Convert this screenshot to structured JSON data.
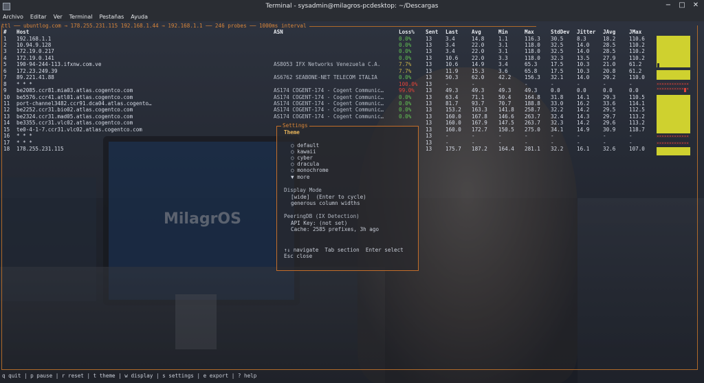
{
  "window": {
    "title": "Terminal - sysadmin@milagros-pcdesktop: ~/Descargas",
    "controls": [
      "−",
      "□",
      "✕"
    ]
  },
  "menu": [
    "Archivo",
    "Editar",
    "Ver",
    "Terminal",
    "Pestañas",
    "Ayuda"
  ],
  "header": {
    "prefix": "ttl",
    "route": "ubuntlog.com → 178.255.231.115 192.168.1.44 → 192.168.1.1",
    "probes": "246 probes",
    "interval": "1000ms interval"
  },
  "columns": [
    "#",
    "Host",
    "ASN",
    "Loss%",
    "Sent",
    "Last",
    "Avg",
    "Min",
    "Max",
    "StdDev",
    "Jitter",
    "JAvg",
    "JMax"
  ],
  "hops": [
    {
      "n": "1",
      "host": "192.168.1.1",
      "asn": "",
      "loss": "0.0%",
      "sent": "13",
      "last": "3.4",
      "avg": "14.8",
      "min": "1.1",
      "max": "116.3",
      "sd": "30.5",
      "jit": "8.3",
      "javg": "18.2",
      "jmax": "110.6",
      "lossLevel": "ok"
    },
    {
      "n": "2",
      "host": "10.94.9.128",
      "asn": "",
      "loss": "0.0%",
      "sent": "13",
      "last": "3.4",
      "avg": "22.0",
      "min": "3.1",
      "max": "118.0",
      "sd": "32.5",
      "jit": "14.0",
      "javg": "28.5",
      "jmax": "110.2",
      "lossLevel": "ok"
    },
    {
      "n": "3",
      "host": "172.19.0.217",
      "asn": "",
      "loss": "0.0%",
      "sent": "13",
      "last": "3.4",
      "avg": "22.0",
      "min": "3.1",
      "max": "118.0",
      "sd": "32.5",
      "jit": "14.0",
      "javg": "28.5",
      "jmax": "110.2",
      "lossLevel": "ok"
    },
    {
      "n": "4",
      "host": "172.19.0.141",
      "asn": "",
      "loss": "0.0%",
      "sent": "13",
      "last": "10.6",
      "avg": "22.0",
      "min": "3.3",
      "max": "118.0",
      "sd": "32.3",
      "jit": "13.5",
      "javg": "27.9",
      "jmax": "110.2",
      "lossLevel": "ok"
    },
    {
      "n": "5",
      "host": "190-94-244-113.ifxnw.com.ve",
      "asn": "AS8053 IFX Networks Venezuela C.A.",
      "loss": "7.7%",
      "sent": "13",
      "last": "10.6",
      "avg": "14.9",
      "min": "3.4",
      "max": "65.3",
      "sd": "17.5",
      "jit": "10.3",
      "javg": "21.0",
      "jmax": "61.2",
      "lossLevel": "mid"
    },
    {
      "n": "6",
      "host": "172.23.249.39",
      "asn": "",
      "loss": "7.7%",
      "sent": "13",
      "last": "11.9",
      "avg": "15.3",
      "min": "3.6",
      "max": "65.8",
      "sd": "17.5",
      "jit": "10.3",
      "javg": "20.8",
      "jmax": "61.2",
      "lossLevel": "mid"
    },
    {
      "n": "7",
      "host": "89.221.41.88",
      "asn": "AS6762 SEABONE-NET TELECOM ITALIA",
      "loss": "0.0%",
      "sent": "13",
      "last": "50.3",
      "avg": "62.0",
      "min": "42.2",
      "max": "156.3",
      "sd": "32.1",
      "jit": "14.0",
      "javg": "29.2",
      "jmax": "110.0",
      "lossLevel": "ok"
    },
    {
      "n": "8",
      "host": "* * *",
      "asn": "",
      "loss": "100.0%",
      "sent": "13",
      "last": "-",
      "avg": "-",
      "min": "-",
      "max": "-",
      "sd": "-",
      "jit": "-",
      "javg": "-",
      "jmax": "-",
      "lossLevel": "bad"
    },
    {
      "n": "9",
      "host": "be2085.ccr81.mia03.atlas.cogentco.com",
      "asn": "AS174 COGENT-174 - Cogent Communic…",
      "loss": "99.0%",
      "sent": "13",
      "last": "49.3",
      "avg": "49.3",
      "min": "49.3",
      "max": "49.3",
      "sd": "0.0",
      "jit": "0.0",
      "javg": "0.0",
      "jmax": "0.0",
      "lossLevel": "bad"
    },
    {
      "n": "10",
      "host": "be5576.ccr41.atl01.atlas.cogentco.com",
      "asn": "AS174 COGENT-174 - Cogent Communic…",
      "loss": "0.0%",
      "sent": "13",
      "last": "63.4",
      "avg": "71.1",
      "min": "50.4",
      "max": "164.8",
      "sd": "31.8",
      "jit": "14.1",
      "javg": "29.3",
      "jmax": "110.5",
      "lossLevel": "ok"
    },
    {
      "n": "11",
      "host": "port-channel3482.ccr91.dca04.atlas.cogento…",
      "asn": "AS174 COGENT-174 - Cogent Communic…",
      "loss": "0.0%",
      "sent": "13",
      "last": "81.7",
      "avg": "93.7",
      "min": "70.7",
      "max": "188.8",
      "sd": "33.0",
      "jit": "16.2",
      "javg": "33.6",
      "jmax": "114.1",
      "lossLevel": "ok"
    },
    {
      "n": "12",
      "host": "be2252.ccr31.bio02.atlas.cogentco.com",
      "asn": "AS174 COGENT-174 - Cogent Communic…",
      "loss": "0.0%",
      "sent": "13",
      "last": "153.2",
      "avg": "163.3",
      "min": "141.8",
      "max": "258.7",
      "sd": "32.2",
      "jit": "14.2",
      "javg": "29.5",
      "jmax": "112.5",
      "lossLevel": "ok"
    },
    {
      "n": "13",
      "host": "be2324.ccr31.mad05.atlas.cogentco.com",
      "asn": "AS174 COGENT-174 - Cogent Communic…",
      "loss": "0.0%",
      "sent": "13",
      "last": "160.0",
      "avg": "167.8",
      "min": "146.6",
      "max": "263.7",
      "sd": "32.4",
      "jit": "14.3",
      "javg": "29.7",
      "jmax": "113.2",
      "lossLevel": "ok"
    },
    {
      "n": "14",
      "host": "be3355.ccr31.vlc02.atlas.cogentco.com",
      "asn": "",
      "loss": "",
      "sent": "13",
      "last": "160.0",
      "avg": "167.9",
      "min": "147.5",
      "max": "263.7",
      "sd": "32.3",
      "jit": "14.2",
      "javg": "29.6",
      "jmax": "113.2",
      "lossLevel": "ok"
    },
    {
      "n": "15",
      "host": "te0-4-1-7.ccr31.vlc02.atlas.cogentco.com",
      "asn": "",
      "loss": "",
      "sent": "13",
      "last": "160.0",
      "avg": "172.7",
      "min": "150.5",
      "max": "275.0",
      "sd": "34.1",
      "jit": "14.9",
      "javg": "30.9",
      "jmax": "118.7",
      "lossLevel": "ok"
    },
    {
      "n": "16",
      "host": "* * *",
      "asn": "",
      "loss": "",
      "sent": "13",
      "last": "-",
      "avg": "-",
      "min": "-",
      "max": "-",
      "sd": "-",
      "jit": "-",
      "javg": "-",
      "jmax": "-",
      "lossLevel": "bad"
    },
    {
      "n": "17",
      "host": "* * *",
      "asn": "",
      "loss": "",
      "sent": "13",
      "last": "-",
      "avg": "-",
      "min": "-",
      "max": "-",
      "sd": "-",
      "jit": "-",
      "javg": "-",
      "jmax": "-",
      "lossLevel": "bad"
    },
    {
      "n": "18",
      "host": "178.255.231.115",
      "asn": "",
      "loss": "",
      "sent": "13",
      "last": "175.7",
      "avg": "187.2",
      "min": "164.4",
      "max": "281.1",
      "sd": "32.2",
      "jit": "16.1",
      "javg": "32.6",
      "jmax": "107.0",
      "lossLevel": "ok"
    }
  ],
  "settings": {
    "title": "Settings",
    "theme_label": "Theme",
    "themes": [
      "○ default",
      "○ kawaii",
      "○ cyber",
      "○ dracula",
      "○ monochrome",
      "▼ more"
    ],
    "display_label": "Display Mode",
    "display_mode": "[wide]  (Enter to cycle)",
    "display_desc": "generous column widths",
    "peering_label": "PeeringDB (IX Detection)",
    "api_key": "API Key: (not set)",
    "cache": "Cache: 2585 prefixes, 3h ago",
    "nav": "↑↓ navigate  Tab section  Enter select",
    "close": "Esc close"
  },
  "footer": "q quit | p pause | r reset | t theme | w display | s settings | e export | ? help",
  "wallpaper_logo": "MilagrOS",
  "colors": {
    "accent": "#d9863a",
    "ok": "#62c254",
    "bad": "#e0433a",
    "graph": "#cfd12f"
  }
}
